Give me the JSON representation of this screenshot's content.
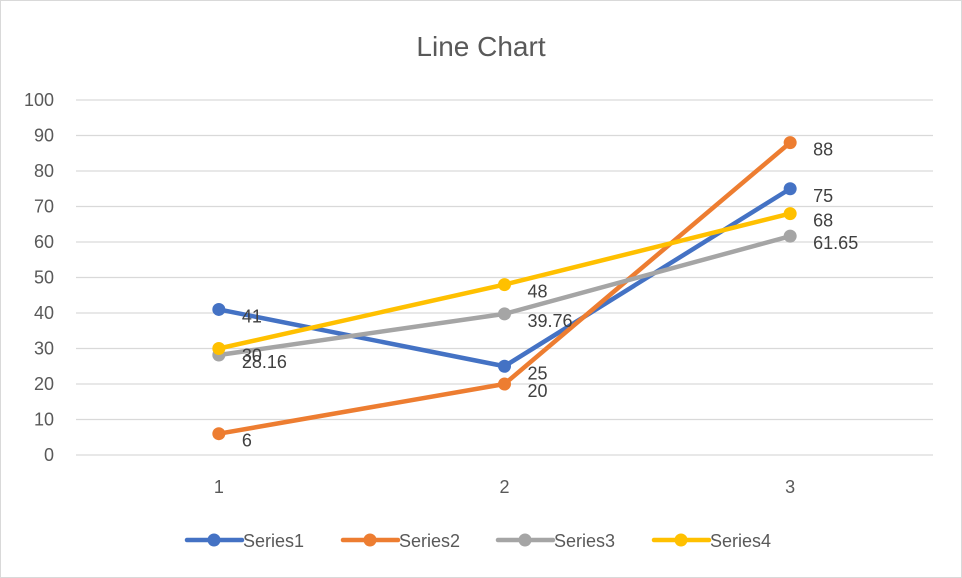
{
  "chart_data": {
    "type": "line",
    "title": "Line Chart",
    "xlabel": "",
    "ylabel": "",
    "categories": [
      "1",
      "2",
      "3"
    ],
    "ylim": [
      0,
      100
    ],
    "yticks": [
      "0",
      "10",
      "20",
      "30",
      "40",
      "50",
      "60",
      "70",
      "80",
      "90",
      "100"
    ],
    "grid": true,
    "legend_position": "bottom",
    "data_labels": true,
    "series": [
      {
        "name": "Series1",
        "color": "#4472c4",
        "values": [
          41,
          25,
          75
        ],
        "labels": [
          "41",
          "25",
          "75"
        ]
      },
      {
        "name": "Series2",
        "color": "#ed7d31",
        "values": [
          6,
          20,
          88
        ],
        "labels": [
          "6",
          "20",
          "88"
        ]
      },
      {
        "name": "Series3",
        "color": "#a5a5a5",
        "values": [
          28.16,
          39.76,
          61.65
        ],
        "labels": [
          "28.16",
          "39.76",
          "61.65"
        ]
      },
      {
        "name": "Series4",
        "color": "#ffc000",
        "values": [
          30,
          48,
          68
        ],
        "labels": [
          "30",
          "48",
          "68"
        ]
      }
    ]
  }
}
